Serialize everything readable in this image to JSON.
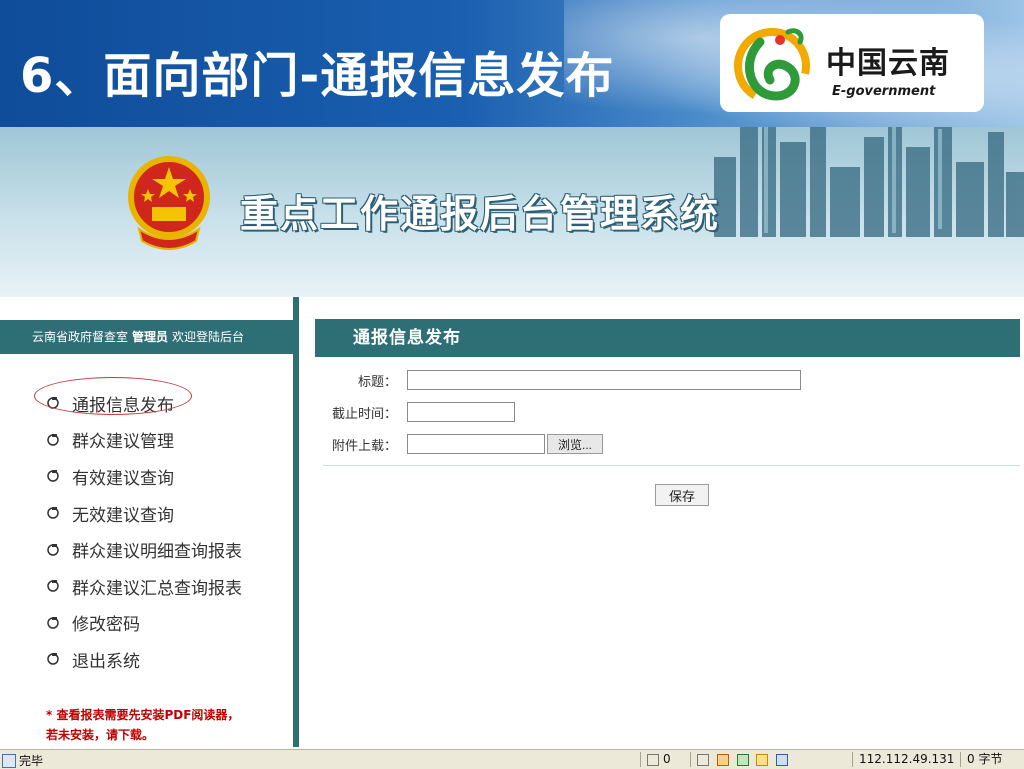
{
  "slide": {
    "title": "6、面向部门-通报信息发布",
    "logo_cn": "中国云南",
    "logo_en": "E-government"
  },
  "system": {
    "title": "重点工作通报后台管理系统"
  },
  "sidebar": {
    "org": "云南省政府督查室",
    "role": "管理员",
    "welcome": "欢迎登陆后台",
    "items": [
      {
        "label": "通报信息发布"
      },
      {
        "label": "群众建议管理"
      },
      {
        "label": "有效建议查询"
      },
      {
        "label": "无效建议查询"
      },
      {
        "label": "群众建议明细查询报表"
      },
      {
        "label": "群众建议汇总查询报表"
      },
      {
        "label": "修改密码"
      },
      {
        "label": "退出系统"
      }
    ],
    "notice_line1": "* 查看报表需要先安装PDF阅读器，",
    "notice_line2": "若未安装，请下载。"
  },
  "main": {
    "header": "通报信息发布",
    "fields": {
      "title_label": "标题：",
      "title_value": "",
      "deadline_label": "截止时间：",
      "deadline_value": "",
      "attachment_label": "附件上载：",
      "attachment_value": "",
      "browse_label": "浏览..."
    },
    "save_label": "保存"
  },
  "statusbar": {
    "done": "完毕",
    "count": "0",
    "ip": "112.112.49.131",
    "bytes": "0 字节"
  },
  "colors": {
    "header_teal": "#2e6f75",
    "slide_blue": "#0f4c99",
    "notice_red": "#c00000",
    "ring_red": "#c23a3a"
  }
}
